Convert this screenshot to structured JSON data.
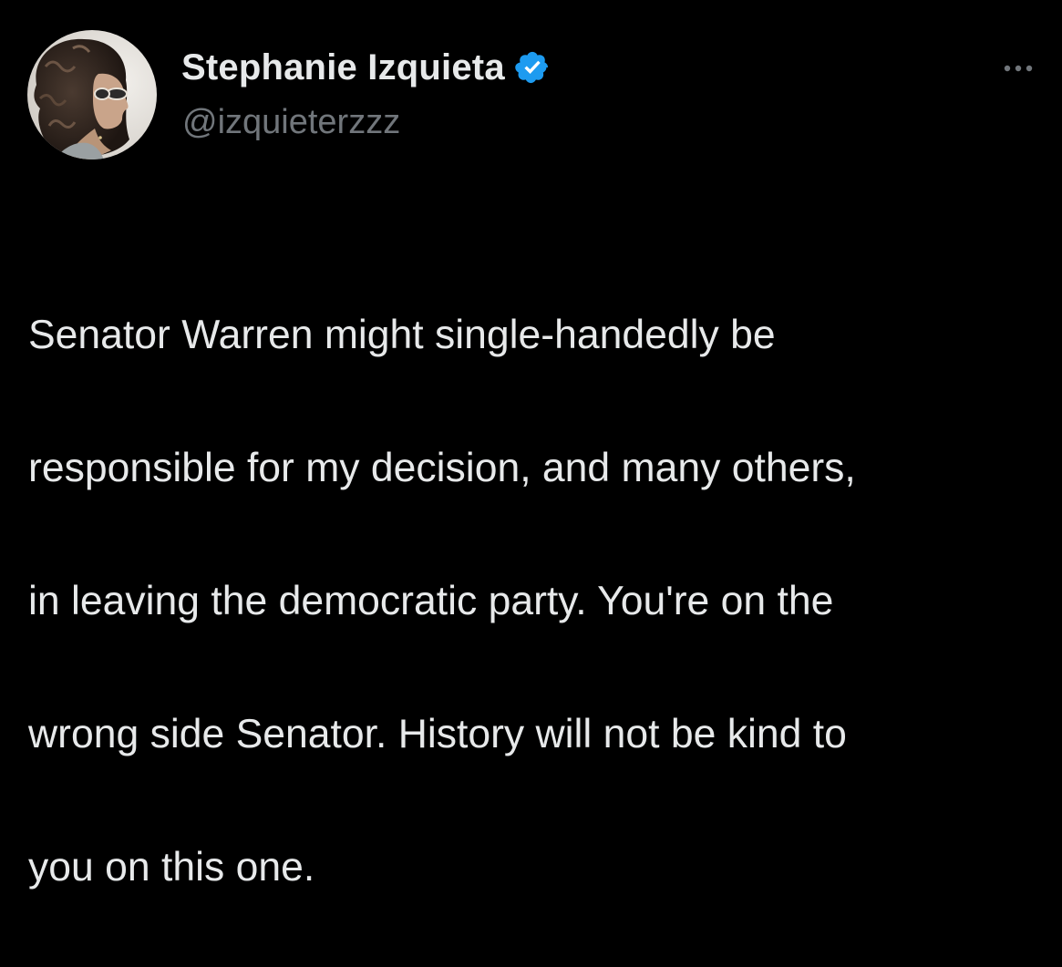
{
  "theme": {
    "background": "#000000",
    "text_primary": "#e7e9ea",
    "text_secondary": "#71767b",
    "verified_badge": "#1d9bf0"
  },
  "author": {
    "avatar_icon": "profile-photo",
    "display_name": "Stephanie Izquieta",
    "verified_icon": "verified-badge-icon",
    "handle": "@izquieterzzz"
  },
  "menu": {
    "icon": "more-options-icon"
  },
  "tweet": {
    "lines": [
      "Senator Warren might single-handedly be",
      "responsible for my decision, and many others,",
      "in leaving the democratic party. You're on the",
      "wrong side Senator. History will not be kind to",
      "you on this one."
    ]
  }
}
